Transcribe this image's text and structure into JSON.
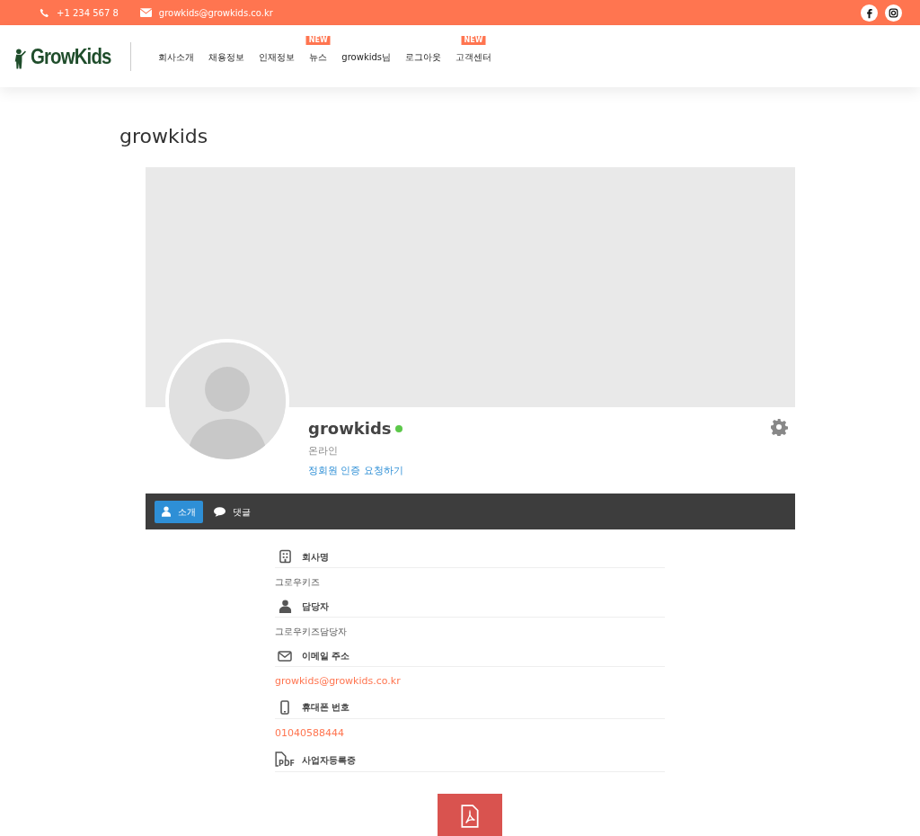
{
  "topbar": {
    "phone": "+1 234 567 8",
    "email": "growkids@growkids.co.kr"
  },
  "header": {
    "logo": "GrowKids",
    "menu": [
      {
        "label": "회사소개"
      },
      {
        "label": "채용정보"
      },
      {
        "label": "인재정보"
      },
      {
        "label": "뉴스",
        "badge": "NEW"
      },
      {
        "label": "growkids님"
      },
      {
        "label": "로그아웃"
      },
      {
        "label": "고객센터",
        "badge": "NEW"
      }
    ]
  },
  "page_title": "growkids",
  "profile": {
    "name": "growkids",
    "online": true,
    "status": "온라인",
    "request_link": "정회원 인증 요청하기"
  },
  "tabs": [
    {
      "label": "소개",
      "selected": true
    },
    {
      "label": "댓글",
      "selected": false
    }
  ],
  "fields": [
    {
      "label": "회사명",
      "value": "그로우키즈",
      "kind": "text"
    },
    {
      "label": "담당자",
      "value": "그로우키즈담당자",
      "kind": "text"
    },
    {
      "label": "이메일 주소",
      "value": "growkids@growkids.co.kr",
      "kind": "link"
    },
    {
      "label": "휴대폰 번호",
      "value": "01040588444",
      "kind": "link"
    },
    {
      "icon_text": "PDF",
      "label": "사업자등록증",
      "kind": "file"
    }
  ]
}
